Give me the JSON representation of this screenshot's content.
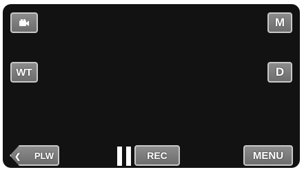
{
  "screen": {
    "top_left_button": {
      "icon": "video-camera-icon"
    },
    "top_right_button": {
      "label": "M"
    },
    "left_mid_button": {
      "label": "WT"
    },
    "right_mid_button": {
      "label": "D"
    },
    "playback_button": {
      "label": "PLW",
      "icon": "back-arrow-icon"
    },
    "pause_indicator": {
      "icon": "pause-icon"
    },
    "rec_button": {
      "label": "REC"
    },
    "menu_button": {
      "label": "MENU"
    }
  }
}
